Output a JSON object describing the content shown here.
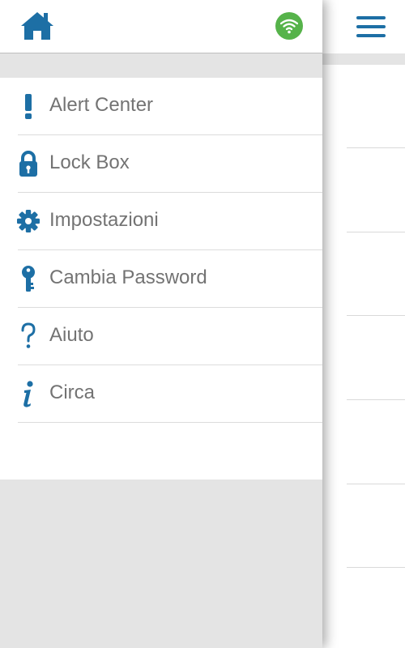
{
  "colors": {
    "accent": "#1d6fa5",
    "wifi_ok": "#56b34a",
    "menu_text": "#737373",
    "panel_gray": "#e4e4e4"
  },
  "header": {
    "home_icon": "home-icon",
    "status_icon": "wifi-icon",
    "menu_icon": "hamburger-icon"
  },
  "menu": {
    "items": [
      {
        "label": "Alert Center",
        "icon": "exclamation-icon"
      },
      {
        "label": "Lock Box",
        "icon": "padlock-icon"
      },
      {
        "label": "Impostazioni",
        "icon": "gear-icon"
      },
      {
        "label": "Cambia Password",
        "icon": "key-icon"
      },
      {
        "label": "Aiuto",
        "icon": "question-icon"
      },
      {
        "label": "Circa",
        "icon": "info-icon"
      }
    ]
  }
}
